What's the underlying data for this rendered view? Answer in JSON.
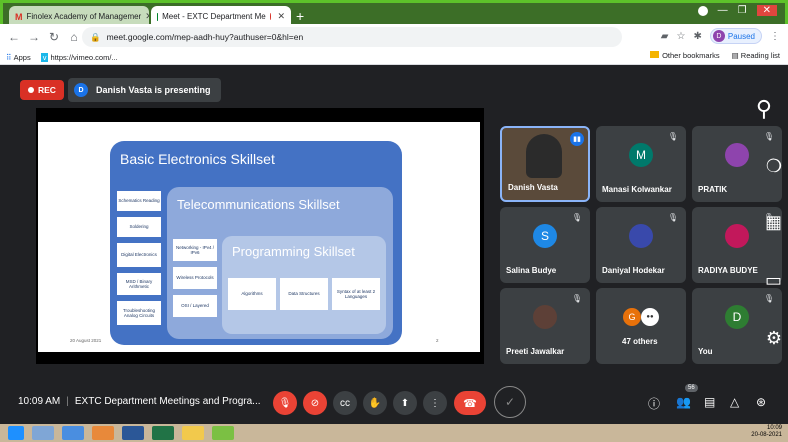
{
  "browser": {
    "tabs": [
      {
        "title": "Finolex Academy of Managemer",
        "active": false
      },
      {
        "title": "Meet - EXTC Department Me",
        "active": true
      }
    ],
    "url": "meet.google.com/mep-aadh-huy?authuser=0&hl=en",
    "profile_initial": "D",
    "profile_status": "Paused",
    "bookmarks": {
      "apps": "Apps",
      "vimeo": "https://vimeo.com/...",
      "other": "Other bookmarks",
      "reading": "Reading list"
    }
  },
  "meet": {
    "rec_label": "REC",
    "presenter_initial": "D",
    "presenter_text": "Danish Vasta is presenting",
    "slide": {
      "outer_title": "Basic Electronics Skillset",
      "outer_items": [
        "Schematics Reading",
        "Soldering",
        "Digital Electronics",
        "MSD / Binary Arithmetic",
        "Troubleshooting Analog Circuits"
      ],
      "mid_title": "Telecommunications Skillset",
      "mid_items": [
        "Networking - IPv4 / IPv6",
        "Wireless Protocols",
        "OSI / Layered"
      ],
      "inner_title": "Programming Skillset",
      "inner_items": [
        "Algorithms",
        "Data Structures",
        "Syntax of at least 2 Languages"
      ],
      "date": "20 August 2021",
      "page": "2"
    },
    "participants": [
      {
        "name": "Danish Vasta",
        "initial": "",
        "color": ""
      },
      {
        "name": "Manasi Kolwankar",
        "initial": "M",
        "color": "#00796b"
      },
      {
        "name": "PRATIK",
        "initial": "",
        "color": "#8e44ad"
      },
      {
        "name": "Salina Budye",
        "initial": "S",
        "color": "#1e88e5"
      },
      {
        "name": "Daniyal Hodekar",
        "initial": "",
        "color": "#3949ab"
      },
      {
        "name": "RADIYA BUDYE",
        "initial": "",
        "color": "#c2185b"
      },
      {
        "name": "Preeti Jawalkar",
        "initial": "",
        "color": "#5d4037"
      },
      {
        "name": "47 others",
        "initial": "G",
        "color": "#e8710a"
      },
      {
        "name": "You",
        "initial": "D",
        "color": "#2e7d32"
      }
    ],
    "bottom": {
      "time": "10:09 AM",
      "meeting_title": "EXTC Department Meetings and Progra...",
      "participant_count": "56"
    }
  },
  "taskbar": {
    "time": "10:09",
    "date": "20-08-2021"
  },
  "colors": {
    "meet_bg": "#202124",
    "tile_bg": "#3c4043",
    "rec_red": "#d93025",
    "slide_blue": "#4472c4"
  }
}
